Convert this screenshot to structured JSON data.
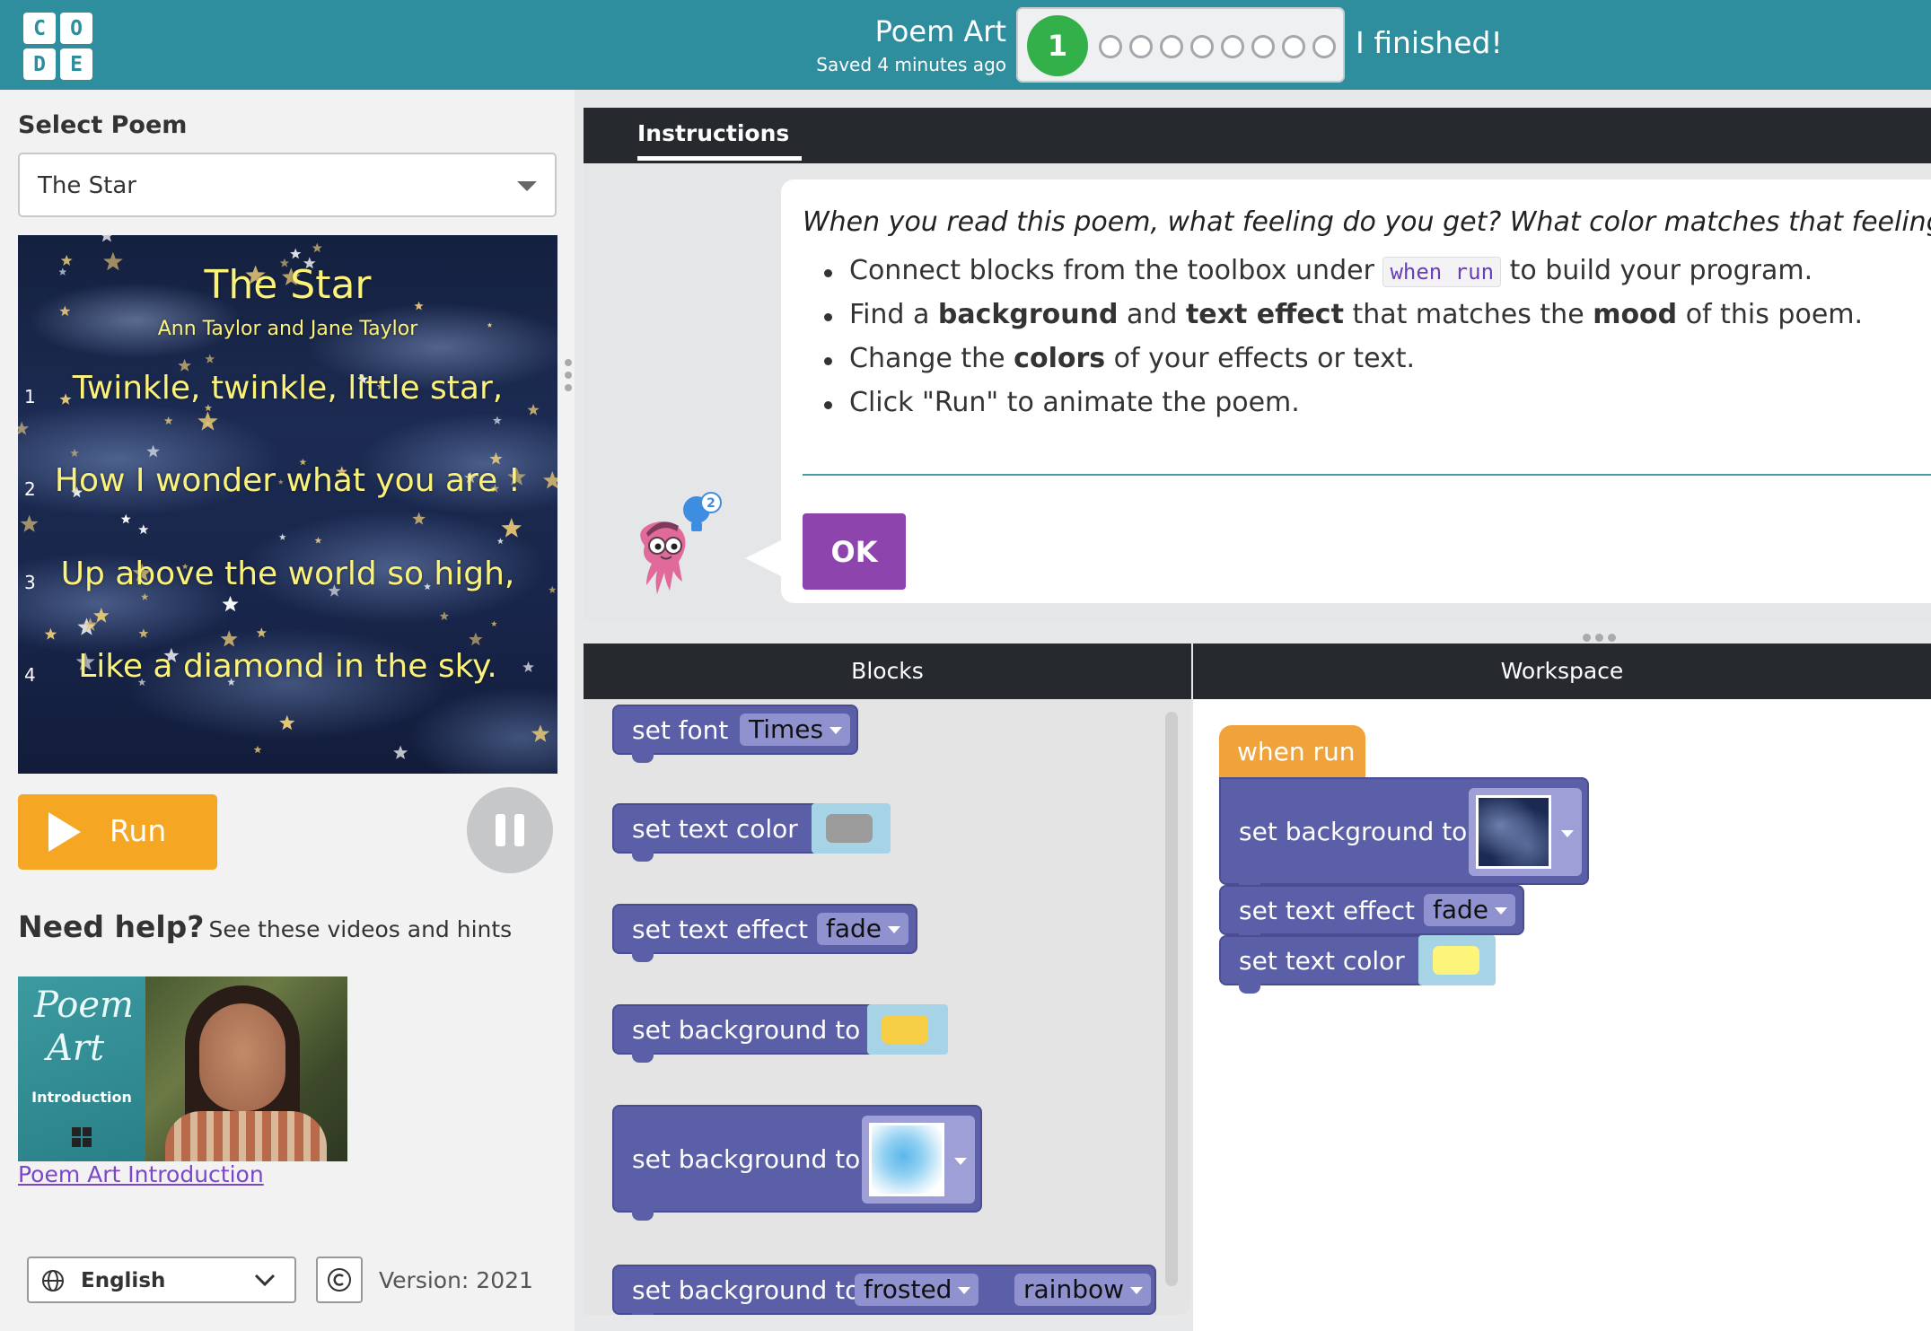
{
  "header": {
    "logo_letters": [
      "C",
      "O",
      "D",
      "E"
    ],
    "project_title": "Poem Art",
    "saved_text": "Saved 4 minutes ago",
    "progress_current": "1",
    "progress_dots": 8,
    "finished_link": "I finished!"
  },
  "left_panel": {
    "select_label": "Select Poem",
    "selected_poem": "The Star",
    "poem": {
      "title": "The Star",
      "author": "Ann Taylor and Jane Taylor",
      "lines": [
        {
          "number": "1",
          "text": "Twinkle, twinkle, little star,"
        },
        {
          "number": "2",
          "text": "How I wonder what you are !"
        },
        {
          "number": "3",
          "text": "Up above the world so high,"
        },
        {
          "number": "4",
          "text": "Like a diamond in the sky."
        }
      ]
    },
    "run_label": "Run",
    "help_title": "Need help?",
    "help_subtitle": "See these videos and hints",
    "video_thumb_title_1": "Poem",
    "video_thumb_title_2": "Art",
    "video_thumb_caption": "Introduction",
    "video_link": "Poem Art Introduction",
    "language": "English",
    "version": "Version: 2021"
  },
  "instructions": {
    "tab_label": "Instructions",
    "prompt": "When you read this poem, what feeling do you get? What color matches that feeling?",
    "item1_pre": "Connect blocks from the toolbox under ",
    "item1_code": "when run",
    "item1_post": " to build your program.",
    "item2_a": "Find a ",
    "item2_b": "background",
    "item2_c": " and ",
    "item2_d": "text effect",
    "item2_e": " that matches the ",
    "item2_f": "mood",
    "item2_g": " of this poem.",
    "item3_a": "Change the ",
    "item3_b": "colors",
    "item3_c": " of your effects or text.",
    "item4": "Click \"Run\" to animate the poem.",
    "ok_label": "OK",
    "hint_badge": "2"
  },
  "toolbox": {
    "header": "Blocks",
    "blocks": [
      {
        "label": "set font",
        "dropdown": "Times"
      },
      {
        "label": "set text color",
        "swatch_color": "#9b9b9b"
      },
      {
        "label": "set text effect",
        "dropdown": "fade"
      },
      {
        "label": "set background to",
        "swatch_color": "#f7cf47"
      },
      {
        "label": "set background to",
        "image": "watercolor-blue"
      },
      {
        "label": "set background to",
        "dropdown": "frosted",
        "dropdown2": "rainbow"
      }
    ]
  },
  "workspace": {
    "header": "Workspace",
    "hat_label": "when run",
    "blocks": [
      {
        "label": "set background to",
        "image": "starry-night"
      },
      {
        "label": "set text effect",
        "dropdown": "fade"
      },
      {
        "label": "set text color",
        "swatch_color": "#fdf57a"
      }
    ]
  },
  "colors": {
    "header_teal": "#2f8e9d",
    "block_purple": "#5b5fa8",
    "hat_orange": "#f0a33a",
    "run_orange": "#f5a623",
    "ok_purple": "#8e44ad",
    "progress_green": "#34b04a",
    "poem_text_yellow": "#fbf27a"
  }
}
